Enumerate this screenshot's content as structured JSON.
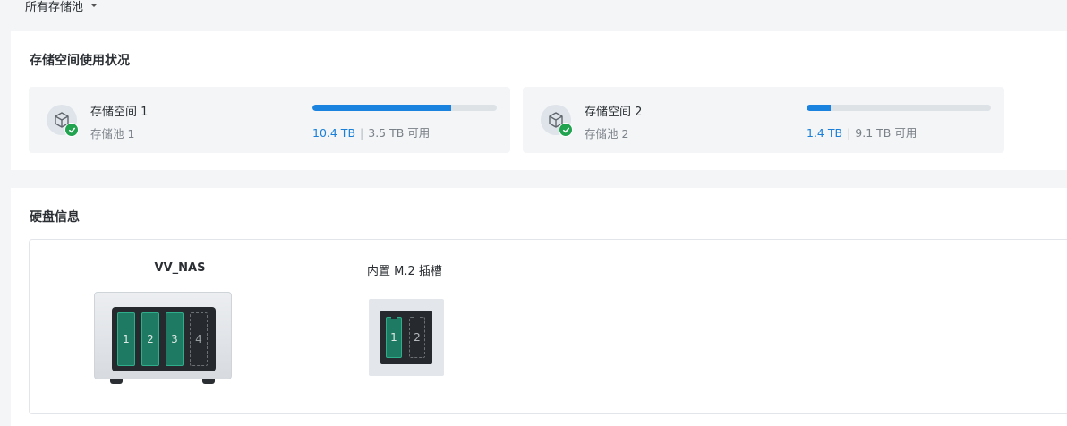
{
  "header": {
    "pool_filter": "所有存储池"
  },
  "usage_section": {
    "title": "存储空间使用状况",
    "volumes": [
      {
        "name": "存储空间 1",
        "pool": "存储池 1",
        "used": "10.4 TB",
        "available": "3.5 TB 可用",
        "usage_fraction": 0.75,
        "status_icon": "check-circle-icon"
      },
      {
        "name": "存储空间 2",
        "pool": "存储池 2",
        "used": "1.4 TB",
        "available": "9.1 TB 可用",
        "usage_fraction": 0.13,
        "status_icon": "check-circle-icon"
      }
    ]
  },
  "disk_section": {
    "title": "硬盘信息",
    "nas": {
      "name": "VV_NAS",
      "bays": [
        {
          "label": "1",
          "installed": true
        },
        {
          "label": "2",
          "installed": true
        },
        {
          "label": "3",
          "installed": true
        },
        {
          "label": "4",
          "installed": false
        }
      ]
    },
    "m2": {
      "name": "内置 M.2 插槽",
      "slots": [
        {
          "label": "1",
          "installed": true
        },
        {
          "label": "2",
          "installed": false
        }
      ]
    }
  },
  "colors": {
    "accent": "#1a83e0",
    "healthy": "#21a350",
    "drive_installed": "#1f7a63"
  }
}
